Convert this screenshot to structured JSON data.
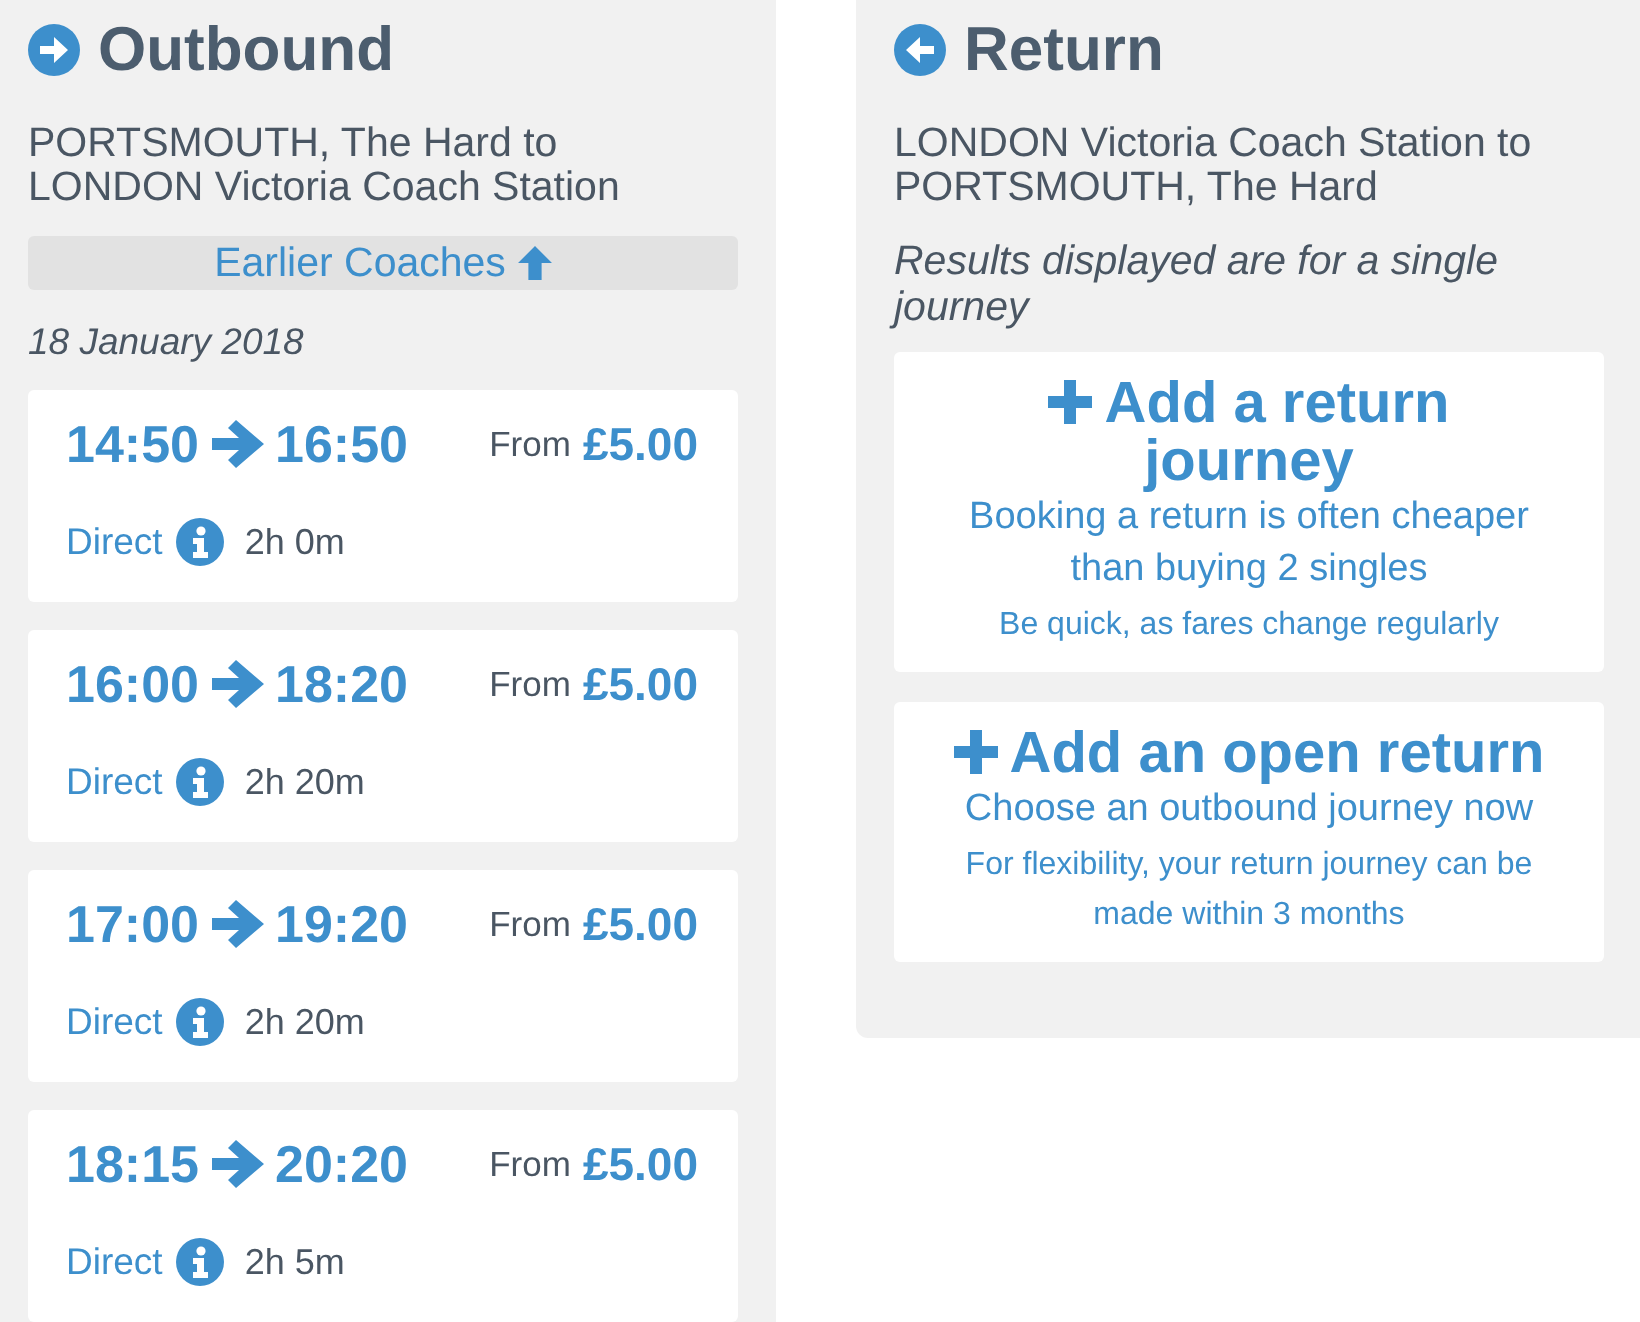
{
  "outbound": {
    "title": "Outbound",
    "route": "PORTSMOUTH, The Hard to LONDON Victoria Coach Station",
    "earlier_button": "Earlier Coaches",
    "date": "18 January 2018",
    "journeys": [
      {
        "depart": "14:50",
        "arrive": "16:50",
        "price_prefix": "From",
        "price": "£5.00",
        "service": "Direct",
        "duration": "2h 0m"
      },
      {
        "depart": "16:00",
        "arrive": "18:20",
        "price_prefix": "From",
        "price": "£5.00",
        "service": "Direct",
        "duration": "2h 20m"
      },
      {
        "depart": "17:00",
        "arrive": "19:20",
        "price_prefix": "From",
        "price": "£5.00",
        "service": "Direct",
        "duration": "2h 20m"
      },
      {
        "depart": "18:15",
        "arrive": "20:20",
        "price_prefix": "From",
        "price": "£5.00",
        "service": "Direct",
        "duration": "2h 5m"
      }
    ]
  },
  "return": {
    "title": "Return",
    "route": "LONDON Victoria Coach Station to PORTSMOUTH, The Hard",
    "note": "Results displayed are for a single journey",
    "options": [
      {
        "title": "Add a return journey",
        "subtitle": "Booking a return is often cheaper than buying 2 singles",
        "detail": "Be quick, as fares change regularly"
      },
      {
        "title": "Add an open return",
        "subtitle": "Choose an outbound journey now",
        "detail": "For flexibility, your return journey can be made within 3 months"
      }
    ]
  }
}
